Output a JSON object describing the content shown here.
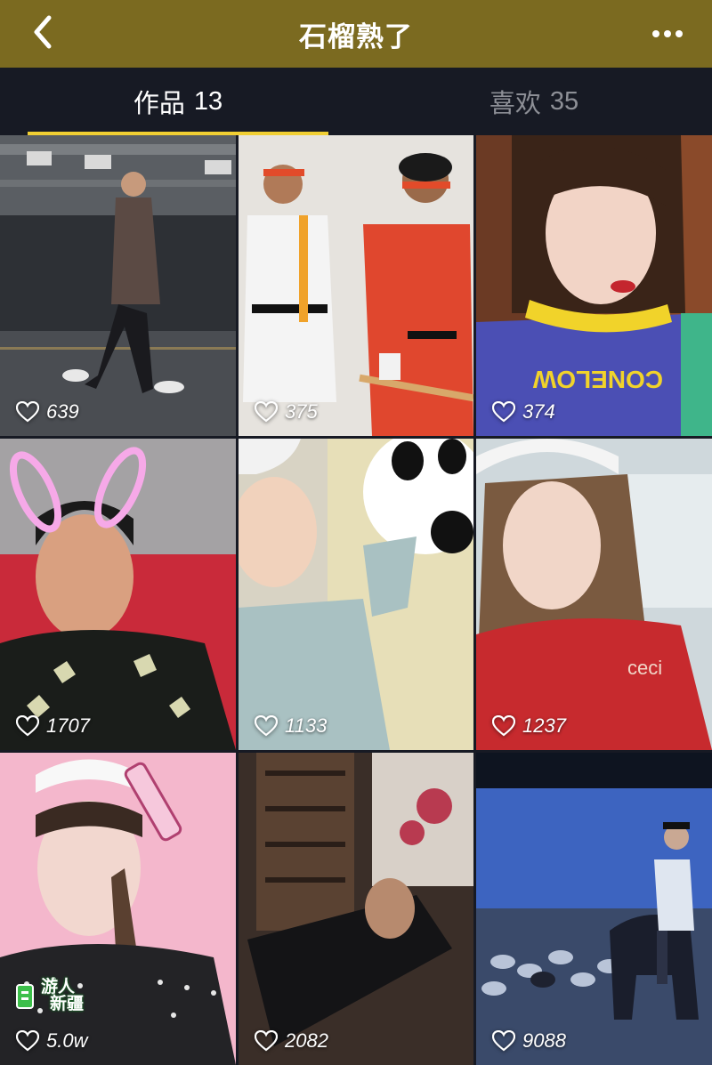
{
  "header": {
    "title": "石榴熟了",
    "back_icon": "chevron-left-icon",
    "more_icon": "more-horizontal-icon"
  },
  "tabs": [
    {
      "label": "作品",
      "count": "13",
      "active": true
    },
    {
      "label": "喜欢",
      "count": "35",
      "active": false
    }
  ],
  "colors": {
    "header_bg": "#7b6a20",
    "tabs_bg": "#171a24",
    "tab_indicator": "#f1cf33"
  },
  "videos": [
    {
      "likes": "639"
    },
    {
      "likes": "375"
    },
    {
      "likes": "374"
    },
    {
      "likes": "1707"
    },
    {
      "likes": "1133"
    },
    {
      "likes": "1237"
    },
    {
      "likes": "5.0w"
    },
    {
      "likes": "2082"
    },
    {
      "likes": "9088"
    }
  ],
  "watermark": {
    "text_line1": "游人",
    "text_line2": "新疆"
  }
}
